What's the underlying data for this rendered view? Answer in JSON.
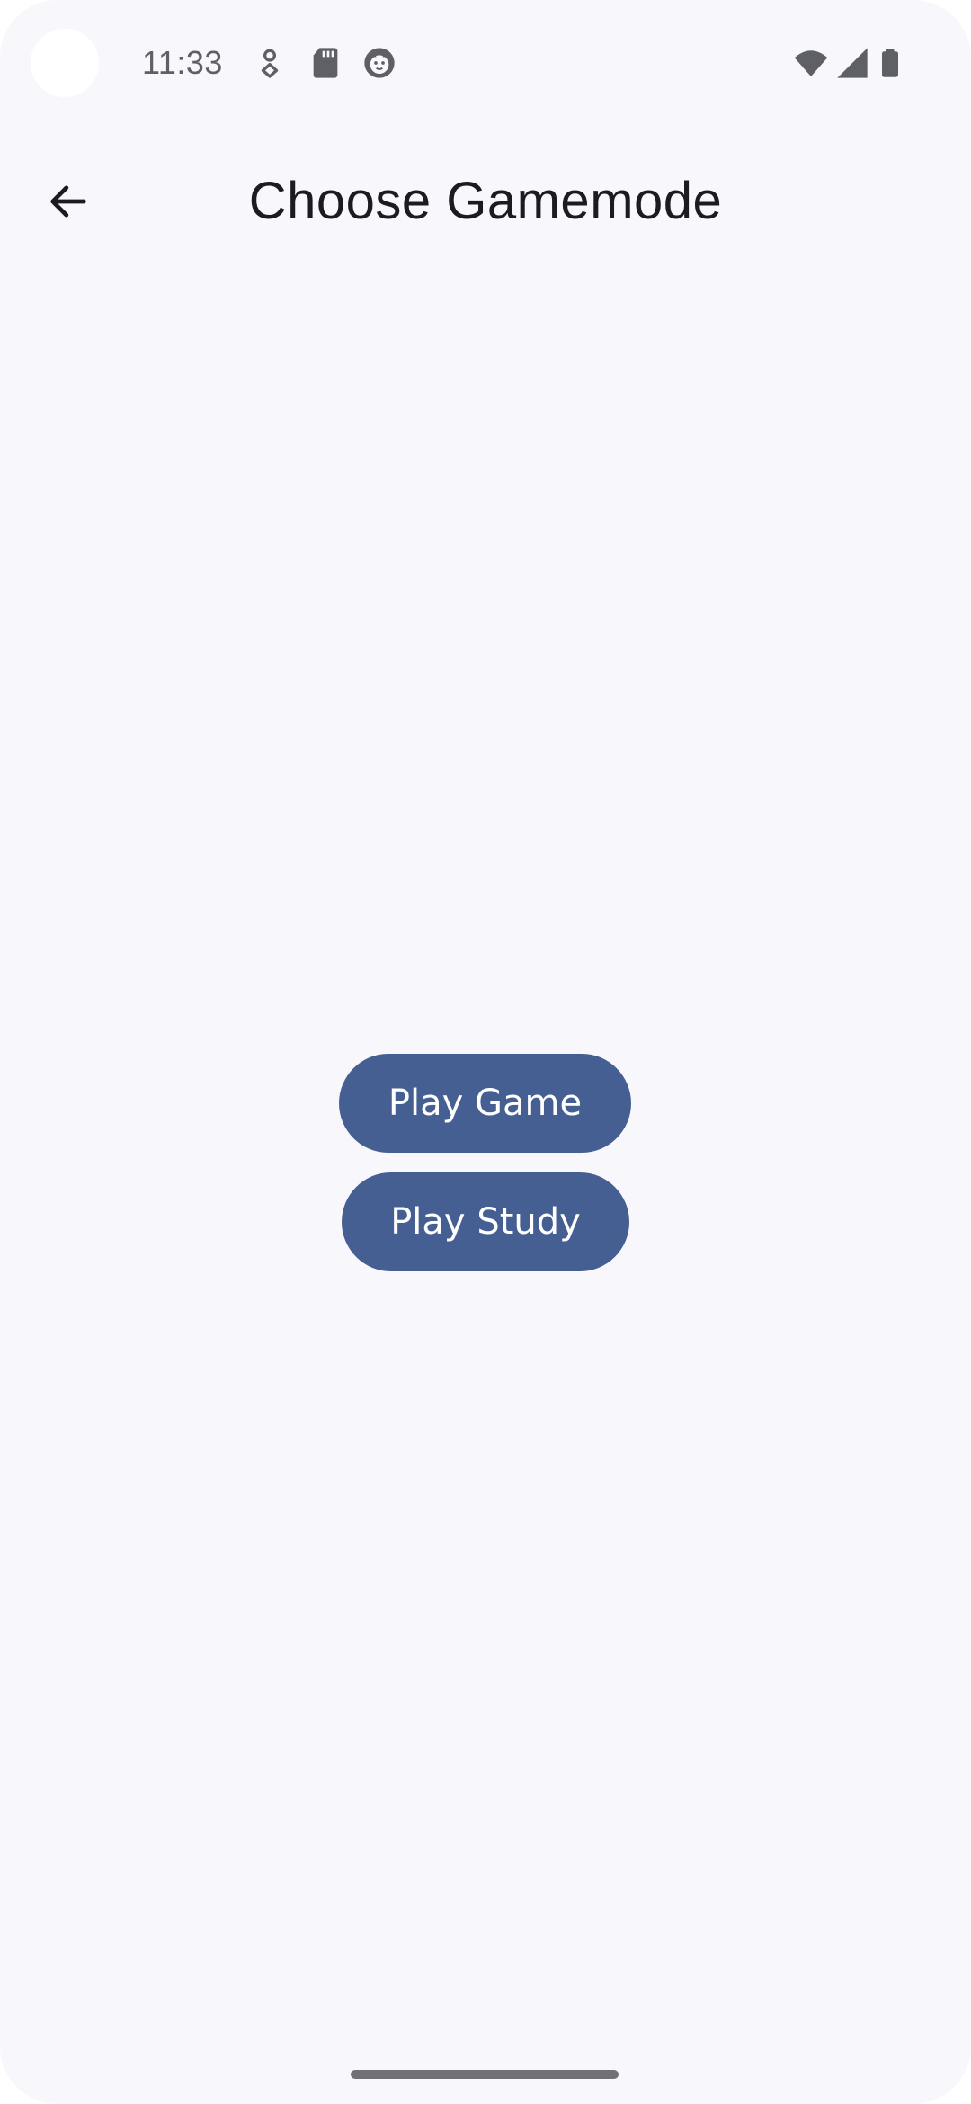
{
  "status_bar": {
    "time": "11:33",
    "icons": [
      "location-pin-icon",
      "sd-card-icon",
      "face-icon",
      "wifi-icon",
      "cell-signal-icon",
      "battery-icon"
    ]
  },
  "app_bar": {
    "back_icon": "arrow-back-icon",
    "title": "Choose Gamemode"
  },
  "actions": {
    "play_game": "Play Game",
    "play_study": "Play Study"
  },
  "colors": {
    "background": "#f8f7fc",
    "button": "#455f92",
    "button_text": "#ffffff",
    "title_text": "#1b1b21",
    "status_text": "#5f5f66"
  }
}
